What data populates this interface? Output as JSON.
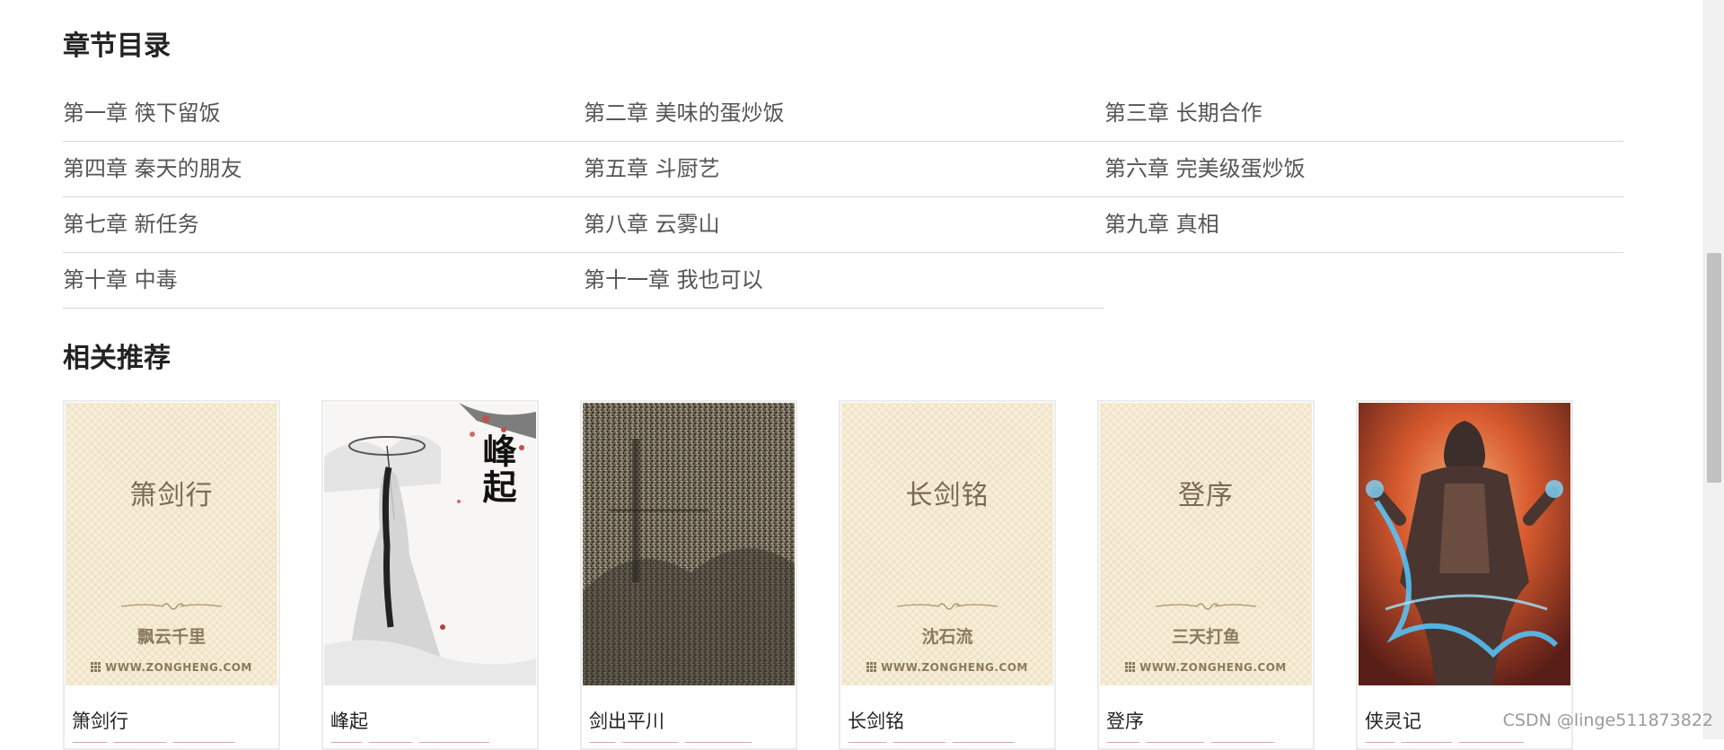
{
  "sections": {
    "chapters_title": "章节目录",
    "recommend_title": "相关推荐"
  },
  "chapters": [
    "第一章 筷下留饭",
    "第二章 美味的蛋炒饭",
    "第三章 长期合作",
    "第四章 秦天的朋友",
    "第五章 斗厨艺",
    "第六章 完美级蛋炒饭",
    "第七章 新任务",
    "第八章 云雾山",
    "第九章 真相",
    "第十章 中毒",
    "第十一章 我也可以"
  ],
  "books": [
    {
      "name": "箫剑行",
      "cover_title": "箫剑行",
      "cover_author": "飘云千里",
      "cover_site": "WWW.ZONGHENG.COM"
    },
    {
      "name": "峰起",
      "cover_calligraphy": "峰起"
    },
    {
      "name": "剑出平川"
    },
    {
      "name": "长剑铭",
      "cover_title": "长剑铭",
      "cover_author": "沈石流",
      "cover_site": "WWW.ZONGHENG.COM"
    },
    {
      "name": "登序",
      "cover_title": "登序",
      "cover_author": "三天打鱼",
      "cover_site": "WWW.ZONGHENG.COM"
    },
    {
      "name": "侠灵记"
    }
  ],
  "watermark": "CSDN @linge511873822",
  "colors": {
    "cover_bg": "#f8efd8",
    "cover_text": "#7a6a52",
    "divider": "#d6d6d6",
    "heading": "#222222"
  }
}
